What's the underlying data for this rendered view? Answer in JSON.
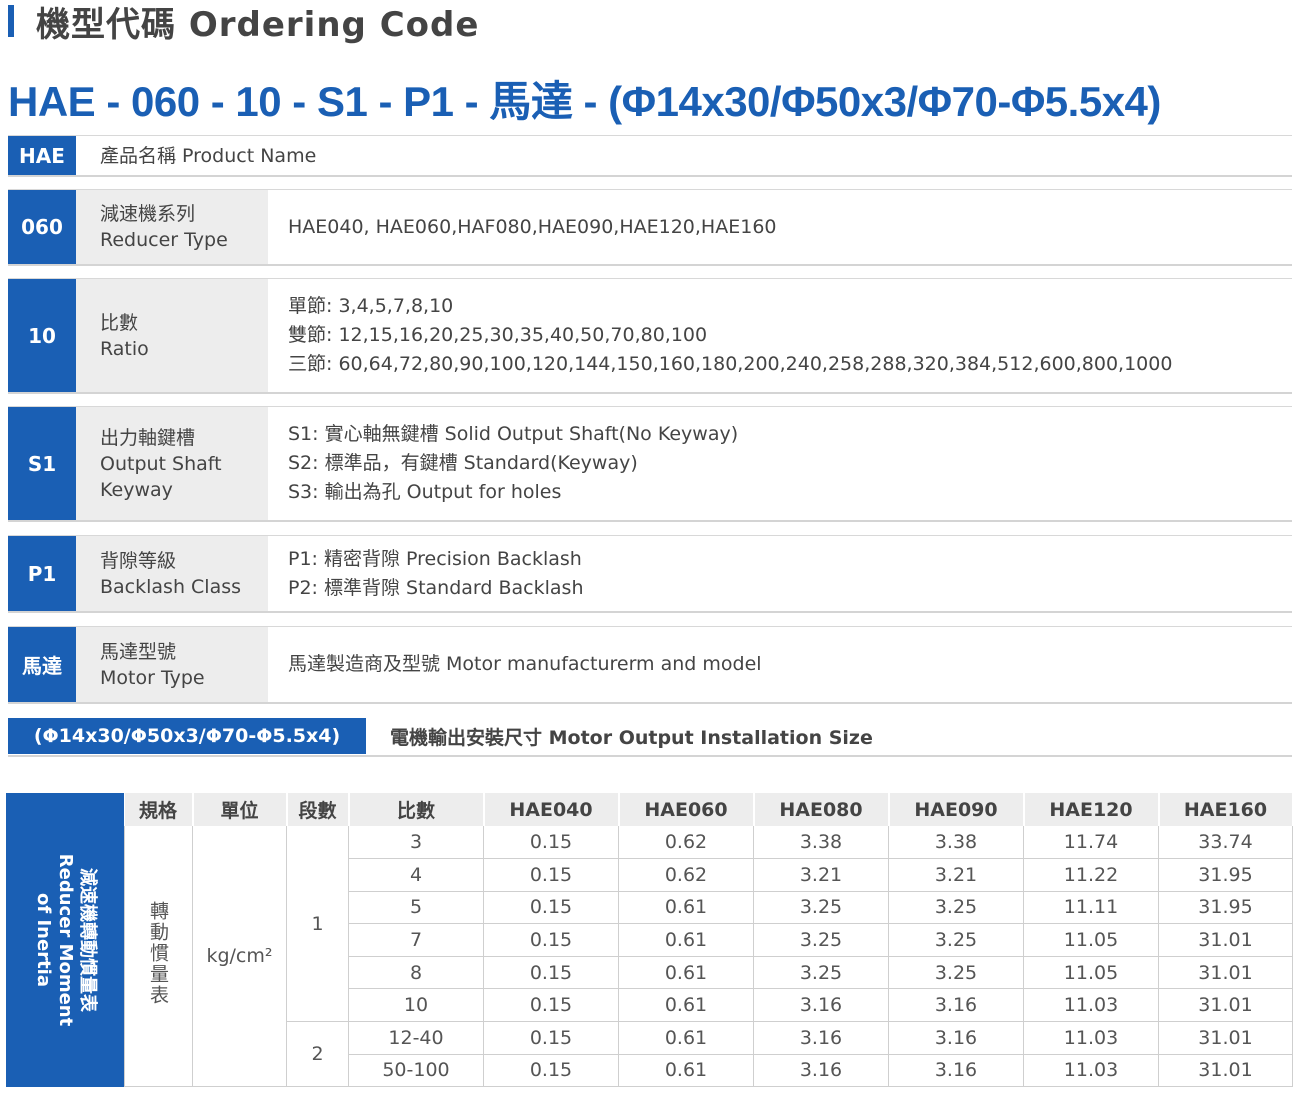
{
  "heading": "機型代碼 Ordering Code",
  "code_line": "HAE - 060 - 10 - S1 - P1 - 馬達 - (Φ14x30/Φ50x3/Φ70-Φ5.5x4)",
  "rows": [
    {
      "code": "HAE",
      "label": [
        "產品名稱 Product Name"
      ],
      "desc": []
    },
    {
      "code": "060",
      "label": [
        "減速機系列",
        "Reducer Type"
      ],
      "desc": [
        "HAE040, HAE060,HAF080,HAE090,HAE120,HAE160"
      ]
    },
    {
      "code": "10",
      "label": [
        "比數",
        "Ratio"
      ],
      "desc": [
        "單節: 3,4,5,7,8,10",
        "雙節: 12,15,16,20,25,30,35,40,50,70,80,100",
        "三節: 60,64,72,80,90,100,120,144,150,160,180,200,240,258,288,320,384,512,600,800,1000"
      ]
    },
    {
      "code": "S1",
      "label": [
        "出力軸鍵槽",
        "Output Shaft",
        "Keyway"
      ],
      "desc": [
        "S1: 實心軸無鍵槽 Solid Output Shaft(No Keyway)",
        "S2: 標準品，有鍵槽 Standard(Keyway)",
        "S3: 輸出為孔 Output for holes"
      ]
    },
    {
      "code": "P1",
      "label": [
        "背隙等級",
        "Backlash Class"
      ],
      "desc": [
        "P1: 精密背隙 Precision Backlash",
        "P2: 標準背隙 Standard Backlash"
      ]
    },
    {
      "code": "馬達",
      "label": [
        "馬達型號",
        "Motor Type"
      ],
      "desc": [
        "馬達製造商及型號 Motor manufacturerm and model"
      ]
    }
  ],
  "size_row": {
    "code": "(Φ14x30/Φ50x3/Φ70-Φ5.5x4)",
    "label": "電機輸出安裝尺寸 Motor Output Installation Size"
  },
  "inertia": {
    "side_title": [
      "減速機轉動慣量表",
      "Reducer Moment",
      "of Inertia"
    ],
    "headers": [
      "規格",
      "單位",
      "段數",
      "比數",
      "HAE040",
      "HAE060",
      "HAE080",
      "HAE090",
      "HAE120",
      "HAE160"
    ],
    "spec": "轉動慣量表",
    "unit": "kg/cm²",
    "stage1": "1",
    "stage2": "2",
    "rows": [
      [
        "3",
        "0.15",
        "0.62",
        "3.38",
        "3.38",
        "11.74",
        "33.74"
      ],
      [
        "4",
        "0.15",
        "0.62",
        "3.21",
        "3.21",
        "11.22",
        "31.95"
      ],
      [
        "5",
        "0.15",
        "0.61",
        "3.25",
        "3.25",
        "11.11",
        "31.95"
      ],
      [
        "7",
        "0.15",
        "0.61",
        "3.25",
        "3.25",
        "11.05",
        "31.01"
      ],
      [
        "8",
        "0.15",
        "0.61",
        "3.25",
        "3.25",
        "11.05",
        "31.01"
      ],
      [
        "10",
        "0.15",
        "0.61",
        "3.16",
        "3.16",
        "11.03",
        "31.01"
      ],
      [
        "12-40",
        "0.15",
        "0.61",
        "3.16",
        "3.16",
        "11.03",
        "31.01"
      ],
      [
        "50-100",
        "0.15",
        "0.61",
        "3.16",
        "3.16",
        "11.03",
        "31.01"
      ]
    ]
  },
  "colors": {
    "brand": "#1a5fb4",
    "label_bg": "#ededed"
  }
}
